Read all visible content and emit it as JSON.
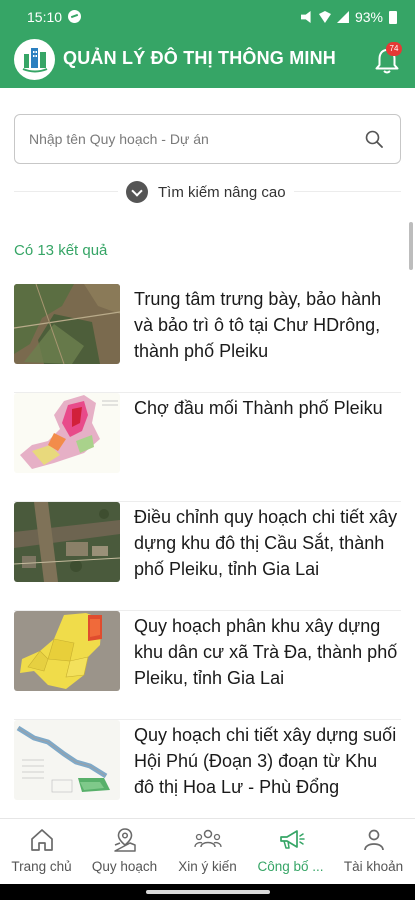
{
  "status_bar": {
    "time": "15:10",
    "battery": "93%"
  },
  "app_bar": {
    "title": "QUẢN LÝ ĐÔ THỊ THÔNG MINH",
    "notification_count": "74",
    "brand_color": "#36a566"
  },
  "search": {
    "placeholder": "Nhập tên Quy hoạch - Dự án",
    "value": "",
    "advanced_label": "Tìm kiếm nâng cao"
  },
  "results": {
    "count_label": "Có 13 kết quả",
    "items": [
      {
        "title": "Trung tâm trưng bày, bảo hành và bảo trì ô tô tại Chư HDrông, thành phố Pleiku",
        "thumbnail": "satellite-map"
      },
      {
        "title": "Chợ đầu mối Thành phố Pleiku",
        "thumbnail": "zoning-map"
      },
      {
        "title": "Điều chỉnh quy hoạch chi tiết xây dựng khu đô thị Cầu Sắt, thành phố Pleiku, tỉnh Gia Lai",
        "thumbnail": "aerial-photo"
      },
      {
        "title": "Quy hoạch phân khu xây dựng khu dân cư xã Trà Đa, thành phố Pleiku, tỉnh Gia Lai",
        "thumbnail": "district-map"
      },
      {
        "title": "Quy hoạch chi tiết xây dựng suối Hội Phú (Đoạn 3) đoạn từ Khu đô thị Hoa Lư - Phù Đổng",
        "thumbnail": "plan-drawing"
      }
    ]
  },
  "bottom_nav": {
    "items": [
      {
        "label": "Trang chủ",
        "icon": "home-icon",
        "active": false
      },
      {
        "label": "Quy hoạch",
        "icon": "map-pin-icon",
        "active": false
      },
      {
        "label": "Xin ý kiến",
        "icon": "people-icon",
        "active": false
      },
      {
        "label": "Công bố ...",
        "icon": "megaphone-icon",
        "active": true
      },
      {
        "label": "Tài khoản",
        "icon": "user-icon",
        "active": false
      }
    ]
  }
}
